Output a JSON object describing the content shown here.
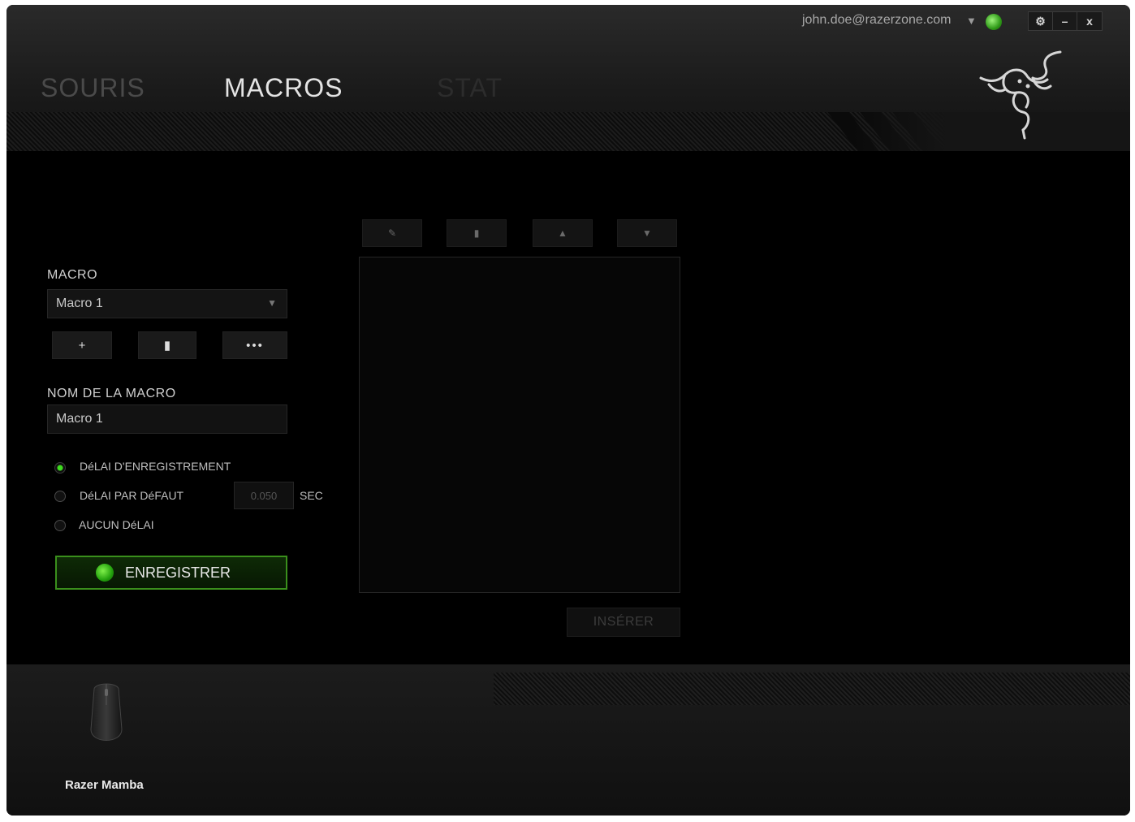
{
  "user": {
    "email": "john.doe@razerzone.com",
    "dropdown_glyph": "▼"
  },
  "window_controls": {
    "settings": "⚙",
    "minimize": "–",
    "close": "x"
  },
  "tabs": [
    {
      "label": "SOURIS",
      "active": false
    },
    {
      "label": "MACROS",
      "active": true
    },
    {
      "label": "STAT",
      "active": false
    }
  ],
  "macro_panel": {
    "macro_label": "MACRO",
    "selected_macro": "Macro 1",
    "add_glyph": "+",
    "delete_glyph": "▮",
    "more_glyph": "•••",
    "name_label": "NOM DE LA MACRO",
    "name_value": "Macro 1",
    "delay_options": [
      {
        "label": "DéLAI D'ENREGISTREMENT",
        "selected": true
      },
      {
        "label": "DéLAI PAR DéFAUT",
        "selected": false
      },
      {
        "label": "AUCUN DéLAI",
        "selected": false
      }
    ],
    "default_delay_value": "0.050",
    "delay_unit": "SEC",
    "record_button": "ENREGISTRER"
  },
  "editor": {
    "toolbar": {
      "edit_glyph": "✎",
      "delete_glyph": "▮",
      "up_glyph": "▲",
      "down_glyph": "▼"
    },
    "insert_button": "INSÉRER"
  },
  "device": {
    "name": "Razer Mamba"
  },
  "colors": {
    "accent_green": "#3fdc20",
    "background": "#000000"
  }
}
